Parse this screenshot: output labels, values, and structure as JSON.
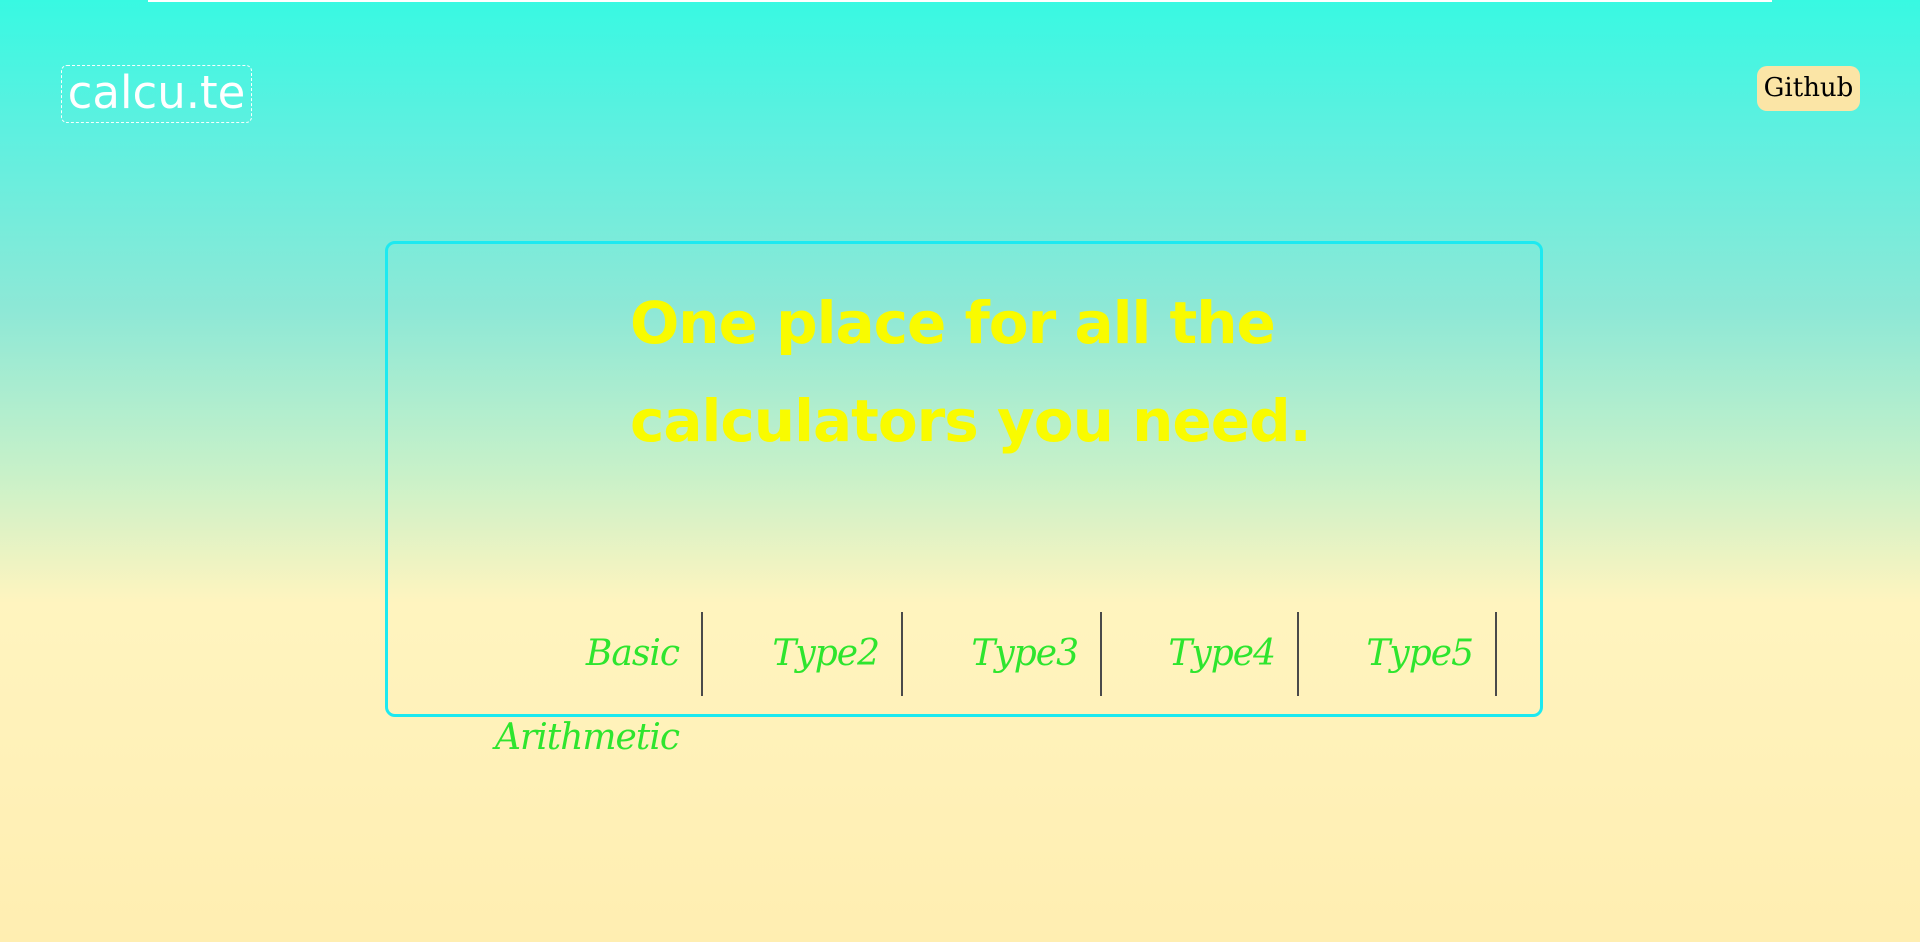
{
  "header": {
    "logo_text": "calcu.te",
    "github_label": "Github"
  },
  "hero": {
    "headline": "One place for all the\ncalculators you need."
  },
  "calculators": [
    {
      "label": "Basic Arithmetic"
    },
    {
      "label": "Type2"
    },
    {
      "label": "Type3"
    },
    {
      "label": "Type4"
    },
    {
      "label": "Type5"
    }
  ],
  "colors": {
    "background_top": "#38f9e2",
    "background_bottom": "#ffeeb1",
    "card_border": "#1de9f0",
    "headline": "#f9fb00",
    "calculator_link": "#2ee52e",
    "github_button": "#fbe5a6"
  }
}
